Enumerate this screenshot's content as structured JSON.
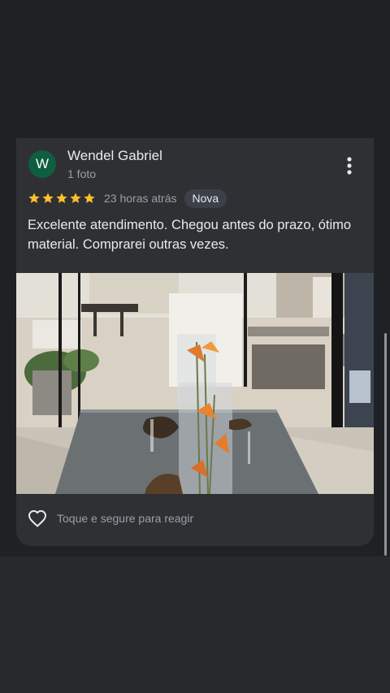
{
  "review": {
    "author_initial": "W",
    "author_name": "Wendel Gabriel",
    "author_meta": "1 foto",
    "rating": 5,
    "rating_max": 5,
    "time_ago": "23 horas atrás",
    "badge": "Nova",
    "text": "Excelente atendimento. Chegou antes do prazo, ótimo material. Comprarei outras vezes.",
    "react_label": "Toque e segure para reagir"
  },
  "icons": {
    "avatar": "user-avatar",
    "more": "more-vert-icon",
    "star": "star-icon",
    "heart": "heart-outline-icon"
  },
  "colors": {
    "avatar_bg": "#0f5e3f",
    "star": "#fbc02d",
    "card_bg": "#2f3033",
    "badge_bg": "#3c4049"
  }
}
